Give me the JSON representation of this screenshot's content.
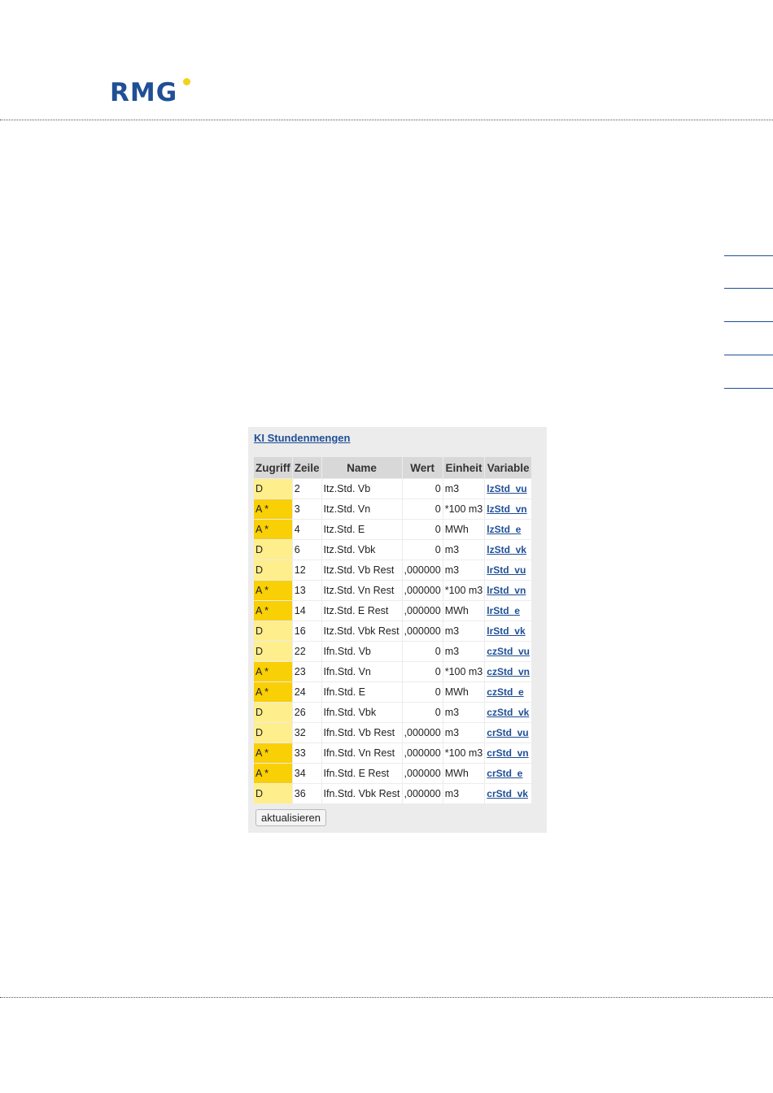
{
  "logo": {
    "text": "RMG"
  },
  "panel": {
    "title": "KI Stundenmengen",
    "columns": [
      "Zugriff",
      "Zeile",
      "Name",
      "Wert",
      "Einheit",
      "Variable"
    ],
    "rows": [
      {
        "access": "D",
        "line": "2",
        "name": "Itz.Std. Vb",
        "value": "0",
        "unit": "m3",
        "variable": "lzStd_vu"
      },
      {
        "access": "A *",
        "line": "3",
        "name": "Itz.Std. Vn",
        "value": "0",
        "unit": "*100 m3",
        "variable": "lzStd_vn"
      },
      {
        "access": "A *",
        "line": "4",
        "name": "Itz.Std. E",
        "value": "0",
        "unit": "MWh",
        "variable": "lzStd_e"
      },
      {
        "access": "D",
        "line": "6",
        "name": "Itz.Std. Vbk",
        "value": "0",
        "unit": "m3",
        "variable": "lzStd_vk"
      },
      {
        "access": "D",
        "line": "12",
        "name": "Itz.Std. Vb Rest",
        "value": ",000000",
        "unit": "m3",
        "variable": "lrStd_vu"
      },
      {
        "access": "A *",
        "line": "13",
        "name": "Itz.Std. Vn Rest",
        "value": ",000000",
        "unit": "*100 m3",
        "variable": "lrStd_vn"
      },
      {
        "access": "A *",
        "line": "14",
        "name": "Itz.Std. E Rest",
        "value": ",000000",
        "unit": "MWh",
        "variable": "lrStd_e"
      },
      {
        "access": "D",
        "line": "16",
        "name": "Itz.Std. Vbk Rest",
        "value": ",000000",
        "unit": "m3",
        "variable": "lrStd_vk"
      },
      {
        "access": "D",
        "line": "22",
        "name": "Ifn.Std. Vb",
        "value": "0",
        "unit": "m3",
        "variable": "czStd_vu"
      },
      {
        "access": "A *",
        "line": "23",
        "name": "Ifn.Std. Vn",
        "value": "0",
        "unit": "*100 m3",
        "variable": "czStd_vn"
      },
      {
        "access": "A *",
        "line": "24",
        "name": "Ifn.Std. E",
        "value": "0",
        "unit": "MWh",
        "variable": "czStd_e"
      },
      {
        "access": "D",
        "line": "26",
        "name": "Ifn.Std. Vbk",
        "value": "0",
        "unit": "m3",
        "variable": "czStd_vk"
      },
      {
        "access": "D",
        "line": "32",
        "name": "Ifn.Std. Vb Rest",
        "value": ",000000",
        "unit": "m3",
        "variable": "crStd_vu"
      },
      {
        "access": "A *",
        "line": "33",
        "name": "Ifn.Std. Vn Rest",
        "value": ",000000",
        "unit": "*100 m3",
        "variable": "crStd_vn"
      },
      {
        "access": "A *",
        "line": "34",
        "name": "Ifn.Std. E Rest",
        "value": ",000000",
        "unit": "MWh",
        "variable": "crStd_e"
      },
      {
        "access": "D",
        "line": "36",
        "name": "Ifn.Std. Vbk Rest",
        "value": ",000000",
        "unit": "m3",
        "variable": "crStd_vk"
      }
    ],
    "refresh_label": "aktualisieren"
  },
  "colors": {
    "brand_blue": "#1f4f96",
    "logo_dot": "#f2d21b",
    "access_d": "#ffee8c",
    "access_a": "#f9cf05"
  }
}
